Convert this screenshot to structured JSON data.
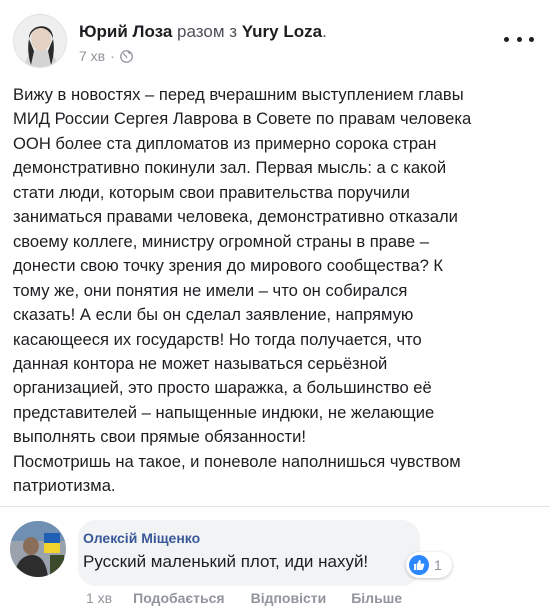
{
  "post": {
    "author": "Юрий Лоза",
    "with_text": "разом з",
    "page": "Yury Loza",
    "page_suffix": ".",
    "time": "7 хв",
    "time_separator": "·",
    "privacy_icon": "globe-icon",
    "more_icon": "more-dots-icon",
    "text_lines": [
      "Вижу в новостях – перед вчерашним выступлением главы",
      "МИД России Сергея Лаврова в Совете по правам человека",
      "ООН более ста дипломатов из примерно сорока стран",
      "демонстративно покинули зал. Первая мысль: а с какой",
      "стати люди, которым свои правительства поручили",
      "заниматься правами человека, демонстративно отказали",
      "своему коллеге, министру огромной страны в праве –",
      "донести свою точку зрения до мирового сообщества? К",
      "тому же, они понятия не имели – что он собирался",
      "сказать! А если бы он сделал заявление, напрямую",
      "касающееся их государств! Но тогда получается, что",
      "данная контора не может называться серьёзной",
      "организацией, это просто шаражка, а большинство её",
      "представителей – напыщенные индюки, не желающие",
      "выполнять свои прямые обязанности!",
      "Посмотришь на такое, и поневоле наполнишься чувством",
      "патриотизма."
    ]
  },
  "comment": {
    "author": "Олексій Міщенко",
    "text": "Русский маленький плот, иди нахуй!",
    "reaction_icon": "like-icon",
    "reaction_count": "1",
    "time": "1 хв",
    "actions": {
      "like": "Подобається",
      "reply": "Відповісти",
      "more": "Більше"
    }
  },
  "colors": {
    "link": "#385898",
    "meta": "#90949c",
    "bubble": "#f2f3f5",
    "like": "#2d88ff"
  }
}
